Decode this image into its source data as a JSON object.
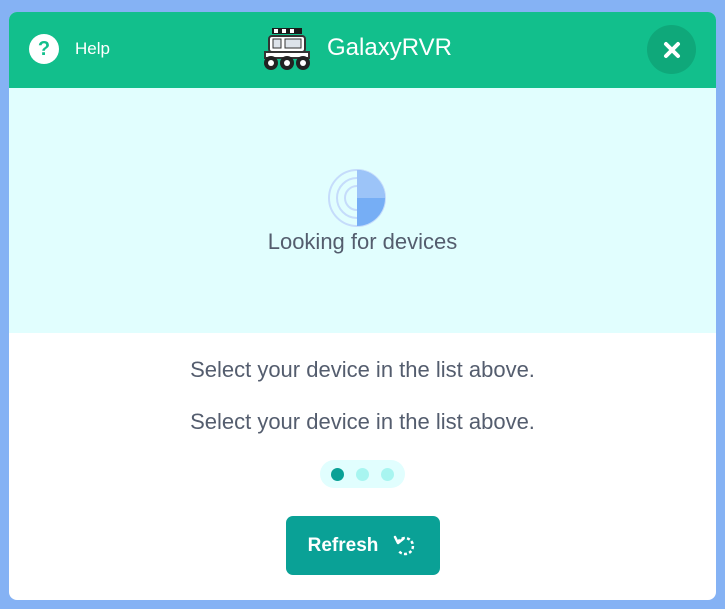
{
  "header": {
    "help_label": "Help",
    "title": "GalaxyRVR",
    "icons": {
      "help": "question-icon",
      "close": "close-icon",
      "logo": "rover-logo"
    }
  },
  "scan": {
    "status_text": "Looking for devices",
    "icon": "radar-icon"
  },
  "instructions": [
    "Select your device in the list above.",
    "Select your device in the list above."
  ],
  "progress": {
    "step_count": 3,
    "active_step": 1
  },
  "refresh": {
    "label": "Refresh",
    "icon": "refresh-icon"
  },
  "colors": {
    "accent": "#12bf8c",
    "button": "#0aa196",
    "scan_bg": "#e1fefe",
    "text": "#545d6e",
    "dot_active": "#0aa196",
    "dot_inactive": "#a8f5f0"
  }
}
